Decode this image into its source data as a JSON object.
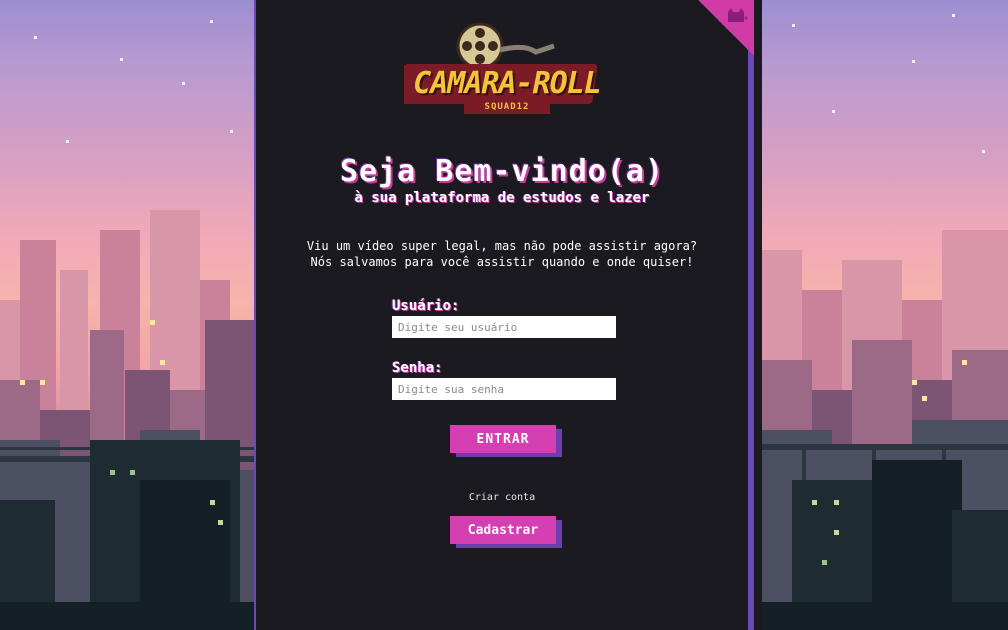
{
  "brand": {
    "logo_main": "CAMARA-ROLL",
    "logo_sub": "SQUAD12"
  },
  "heading": {
    "title": "Seja Bem-vindo(a)",
    "subtitle": "à sua plataforma de estudos e lazer"
  },
  "intro": {
    "line1": "Viu um vídeo super legal, mas não pode assistir agora?",
    "line2": "Nós salvamos para você assistir quando e onde quiser!"
  },
  "form": {
    "user_label": "Usuário:",
    "user_placeholder": "Digite seu usuário",
    "user_value": "",
    "pass_label": "Senha:",
    "pass_placeholder": "Digite sua senha",
    "pass_value": "",
    "submit_label": "ENTRAR"
  },
  "signup": {
    "prompt": "Criar conta",
    "button_label": "Cadastrar"
  },
  "icons": {
    "corner": "cat-icon",
    "logo": "film-reel-icon"
  },
  "colors": {
    "accent_pink": "#d43fb2",
    "accent_purple": "#6a3fb0",
    "panel_bg": "#1c1a21"
  }
}
